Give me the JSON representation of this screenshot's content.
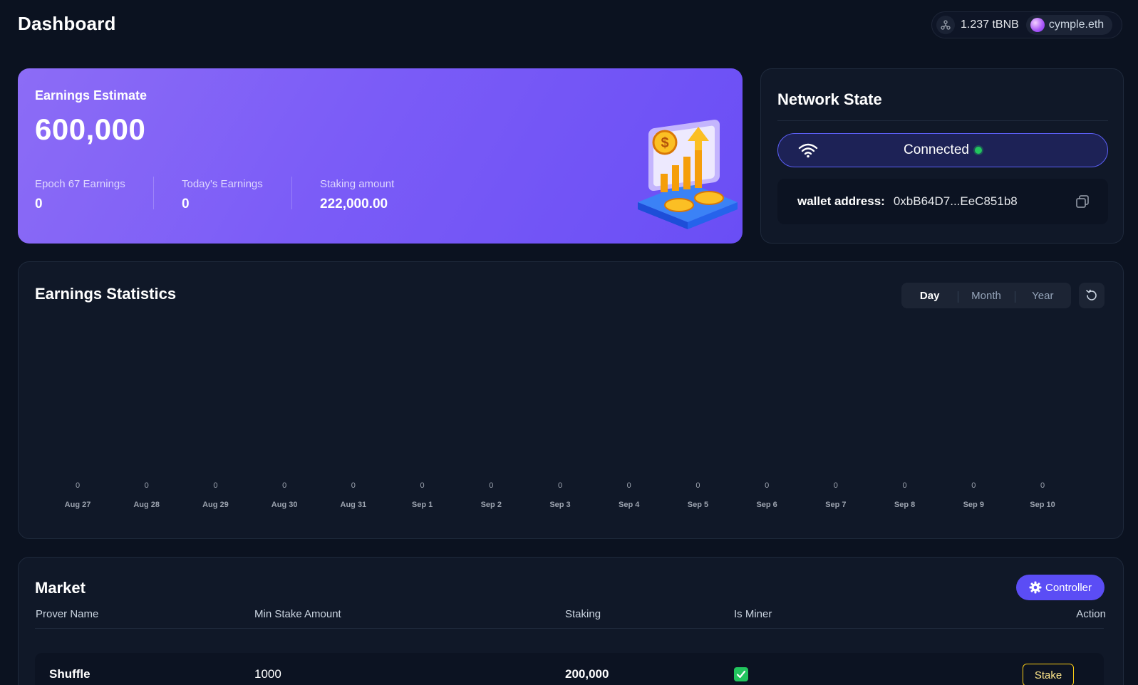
{
  "header": {
    "title": "Dashboard",
    "network_icon": "network-icon",
    "balance": "1.237 tBNB",
    "account": "cymple.eth"
  },
  "earnings": {
    "title": "Earnings Estimate",
    "total": "600,000",
    "stats": [
      {
        "label": "Epoch 67 Earnings",
        "value": "0"
      },
      {
        "label": "Today's Earnings",
        "value": "0"
      },
      {
        "label": "Staking amount",
        "value": "222,000.00"
      }
    ],
    "illustration": "growth-chart-coins-illustration"
  },
  "network": {
    "title": "Network State",
    "connect_label": "Connected",
    "status_color": "#22c55e",
    "wallet_label": "wallet address:",
    "wallet_value": "0xbB64D7...EeC851b8"
  },
  "statistics": {
    "title": "Earnings Statistics",
    "tabs": [
      "Day",
      "Month",
      "Year"
    ],
    "active_tab": "Day"
  },
  "chart_data": {
    "type": "bar",
    "categories": [
      "Aug 27",
      "Aug 28",
      "Aug 29",
      "Aug 30",
      "Aug 31",
      "Sep 1",
      "Sep 2",
      "Sep 3",
      "Sep 4",
      "Sep 5",
      "Sep 6",
      "Sep 7",
      "Sep 8",
      "Sep 9",
      "Sep 10"
    ],
    "values": [
      0,
      0,
      0,
      0,
      0,
      0,
      0,
      0,
      0,
      0,
      0,
      0,
      0,
      0,
      0
    ],
    "title": "Earnings Statistics",
    "xlabel": "",
    "ylabel": "",
    "grid": false
  },
  "market": {
    "title": "Market",
    "controller_label": "Controller",
    "columns": [
      "Prover Name",
      "Min Stake Amount",
      "Staking",
      "Is Miner",
      "Action"
    ],
    "rows": [
      {
        "name": "Shuffle",
        "min_stake": "1000",
        "staking": "200,000",
        "is_miner": true,
        "action": "Stake"
      }
    ]
  },
  "colors": {
    "background": "#0b1220",
    "accent": "#5b4df5",
    "earnings_gradient_start": "#8c6cf6",
    "earnings_gradient_end": "#6a4ef5",
    "stake_border": "#facc15"
  }
}
